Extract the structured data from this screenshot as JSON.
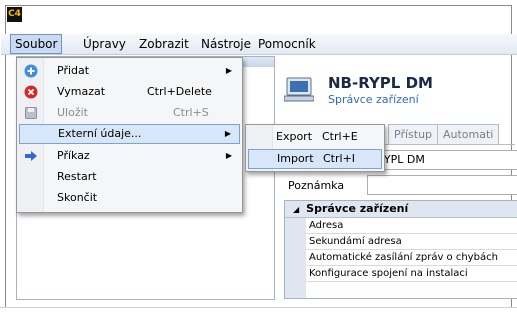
{
  "app": {
    "icon_text": "C4"
  },
  "menubar": {
    "items": [
      {
        "label": "Soubor"
      },
      {
        "label": "Úpravy"
      },
      {
        "label": "Zobrazit"
      },
      {
        "label": "Nástroje"
      },
      {
        "label": "Pomocník"
      }
    ]
  },
  "soubor_menu": {
    "items": [
      {
        "label": "Přidat",
        "shortcut": "",
        "icon": "plus-circle-icon"
      },
      {
        "label": "Vymazat",
        "shortcut": "Ctrl+Delete",
        "icon": "delete-circle-icon"
      },
      {
        "label": "Uložit",
        "shortcut": "Ctrl+S",
        "icon": "save-disk-icon"
      },
      {
        "label": "Externí údaje...",
        "shortcut": "",
        "icon": ""
      },
      {
        "label": "Příkaz",
        "shortcut": "",
        "icon": "arrow-right-icon"
      },
      {
        "label": "Restart",
        "shortcut": "",
        "icon": ""
      },
      {
        "label": "Skončit",
        "shortcut": "",
        "icon": ""
      }
    ]
  },
  "external_submenu": {
    "items": [
      {
        "label": "Export",
        "shortcut": "Ctrl+E"
      },
      {
        "label": "Import",
        "shortcut": "Ctrl+I"
      }
    ]
  },
  "device": {
    "name": "NB-RYPL DM",
    "subtitle": "Správce zařízení",
    "name_field_value": "-RYPL DM"
  },
  "tabs": [
    {
      "label": "osti"
    },
    {
      "label": "Přístup"
    },
    {
      "label": "Automati"
    }
  ],
  "form": {
    "note_label": "Poznámka",
    "note_value": ""
  },
  "properties": {
    "group_title": "Správce zařízení",
    "rows": [
      {
        "label": "Adresa"
      },
      {
        "label": "Sekundámí adresa"
      },
      {
        "label": "Automatické zasílání zpráv o chybách"
      },
      {
        "label": "Konfigurace spojení na instalaci"
      }
    ]
  },
  "colors": {
    "accent": "#2f6ab8",
    "menu_highlight": "#d7e6f8",
    "menu_highlight_border": "#7da2ce"
  }
}
